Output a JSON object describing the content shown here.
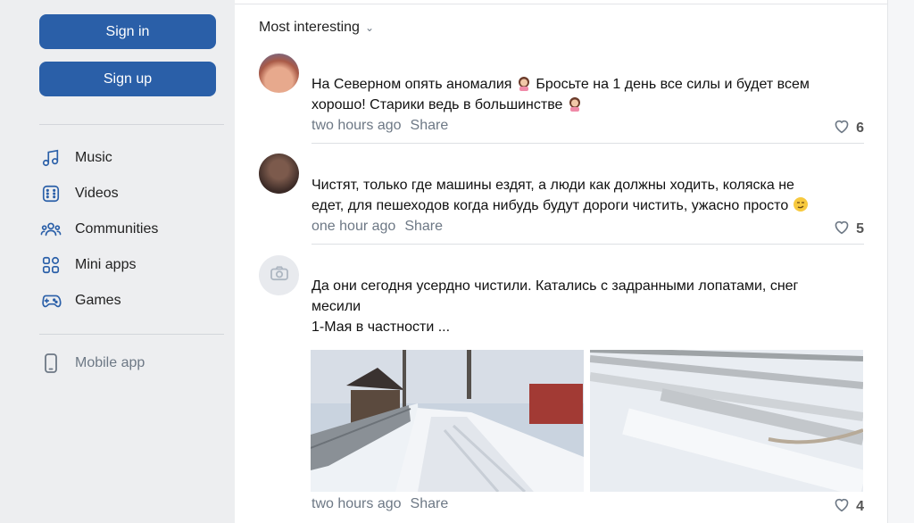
{
  "auth": {
    "signin_label": "Sign in",
    "signup_label": "Sign up"
  },
  "nav": {
    "items": [
      {
        "label": "Music",
        "icon": "music-icon"
      },
      {
        "label": "Videos",
        "icon": "video-icon"
      },
      {
        "label": "Communities",
        "icon": "communities-icon"
      },
      {
        "label": "Mini apps",
        "icon": "mini-apps-icon"
      },
      {
        "label": "Games",
        "icon": "gamepad-icon"
      }
    ],
    "mobile_app": "Mobile app"
  },
  "feed": {
    "sort_label": "Most interesting",
    "comments": [
      {
        "text_line1": "На Северном опять аномалия",
        "text_line1b": "Бросьте на 1 день все силы и будет всем",
        "text_line2": "хорошо! Старики ведь в большинстве",
        "time": "two hours ago",
        "share": "Share",
        "likes": "6"
      },
      {
        "text_line1": "Чистят, только где машины ездят, а люди как должны ходить, коляска не",
        "text_line2": "едет, для пешеходов когда нибудь будут дороги чистить, ужасно просто",
        "time": "one hour ago",
        "share": "Share",
        "likes": "5"
      },
      {
        "text_line1": "Да они сегодня усердно чистили. Катались с задранными лопатами, снег",
        "text_line2": "месили",
        "text_line3": "1-Мая в частности ...",
        "time": "two hours ago",
        "share": "Share",
        "likes": "4"
      }
    ]
  },
  "colors": {
    "primary_button": "#2a5fa8",
    "muted_text": "#6d7885",
    "background": "#edeef0"
  }
}
